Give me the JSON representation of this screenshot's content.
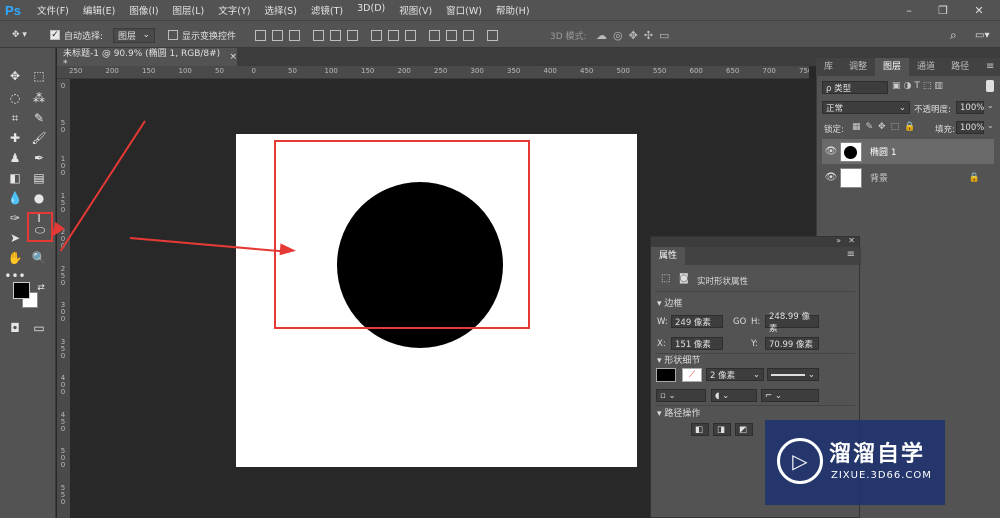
{
  "app": {
    "logo": "Ps"
  },
  "menu": [
    "文件(F)",
    "编辑(E)",
    "图像(I)",
    "图层(L)",
    "文字(Y)",
    "选择(S)",
    "滤镜(T)",
    "3D(D)",
    "视图(V)",
    "窗口(W)",
    "帮助(H)"
  ],
  "options_bar": {
    "auto_select_label": "自动选择:",
    "auto_select_value": "图层",
    "show_transform_label": "显示变换控件",
    "mode3d_label": "3D 模式:"
  },
  "document": {
    "tab_title": "未标题-1 @ 90.9% (椭圆 1, RGB/8#) *",
    "close": "×"
  },
  "rulers": {
    "top": [
      "250",
      "200",
      "150",
      "100",
      "50",
      "0",
      "50",
      "100",
      "150",
      "200",
      "250",
      "300",
      "350",
      "400",
      "450",
      "500",
      "550",
      "600",
      "650",
      "700",
      "750"
    ],
    "left": [
      "0",
      "5\n0",
      "1\n0\n0",
      "1\n5\n0",
      "2\n0\n0",
      "2\n5\n0",
      "3\n0\n0",
      "3\n5\n0",
      "4\n0\n0",
      "4\n5\n0",
      "5\n0\n0",
      "5\n5\n0"
    ]
  },
  "panels": {
    "tabs": [
      "库",
      "调整",
      "图层",
      "通道",
      "路径"
    ],
    "active_tab": "图层",
    "filter_kind": "ρ 类型",
    "blend_mode": "正常",
    "opacity_label": "不透明度:",
    "opacity_value": "100%",
    "lock_label": "锁定:",
    "fill_label": "填充:",
    "fill_value": "100%",
    "layers": [
      {
        "name": "椭圆 1",
        "selected": true
      },
      {
        "name": "背景",
        "selected": false,
        "locked": true
      }
    ]
  },
  "properties": {
    "tab": "属性",
    "shape_title": "实时形状属性",
    "bbox_section": "边框",
    "w_label": "W:",
    "w_value": "249 像素",
    "link": "GO",
    "h_label": "H:",
    "h_value": "248.99 像素",
    "x_label": "X:",
    "x_value": "151 像素",
    "y_label": "Y:",
    "y_value": "70.99 像素",
    "shape_section": "形状细节",
    "stroke_width": "2 像素",
    "path_section": "路径操作"
  },
  "watermark": {
    "brand": "溜溜自学",
    "url": "ZIXUE.3D66.COM"
  },
  "colors": {
    "accent": "#e53935",
    "ps_blue": "#31a8ff",
    "fg": "#000000",
    "bg": "#ffffff"
  }
}
